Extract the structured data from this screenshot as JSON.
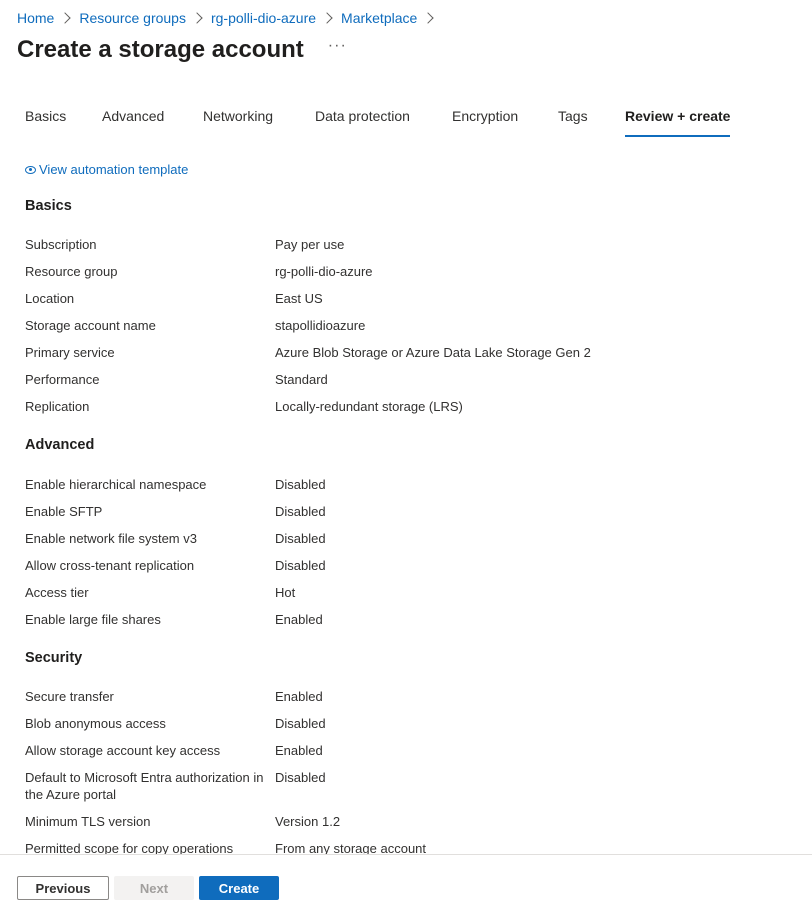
{
  "breadcrumb": [
    {
      "label": "Home"
    },
    {
      "label": "Resource groups"
    },
    {
      "label": "rg-polli-dio-azure"
    },
    {
      "label": "Marketplace"
    }
  ],
  "page": {
    "title": "Create a storage account",
    "more_label": "···"
  },
  "tabs": [
    {
      "label": "Basics"
    },
    {
      "label": "Advanced"
    },
    {
      "label": "Networking"
    },
    {
      "label": "Data protection"
    },
    {
      "label": "Encryption"
    },
    {
      "label": "Tags"
    },
    {
      "label": "Review + create",
      "active": true
    }
  ],
  "automation_link": {
    "label": "View automation template",
    "icon": "eye-icon"
  },
  "sections": [
    {
      "title": "Basics",
      "rows": [
        {
          "key": "Subscription",
          "value": "Pay per use"
        },
        {
          "key": "Resource group",
          "value": "rg-polli-dio-azure"
        },
        {
          "key": "Location",
          "value": "East US"
        },
        {
          "key": "Storage account name",
          "value": "stapollidioazure"
        },
        {
          "key": "Primary service",
          "value": "Azure Blob Storage or Azure Data Lake Storage Gen 2"
        },
        {
          "key": "Performance",
          "value": "Standard"
        },
        {
          "key": "Replication",
          "value": "Locally-redundant storage (LRS)"
        }
      ]
    },
    {
      "title": "Advanced",
      "rows": [
        {
          "key": "Enable hierarchical namespace",
          "value": "Disabled"
        },
        {
          "key": "Enable SFTP",
          "value": "Disabled"
        },
        {
          "key": "Enable network file system v3",
          "value": "Disabled"
        },
        {
          "key": "Allow cross-tenant replication",
          "value": "Disabled"
        },
        {
          "key": "Access tier",
          "value": "Hot"
        },
        {
          "key": "Enable large file shares",
          "value": "Enabled"
        }
      ]
    },
    {
      "title": "Security",
      "rows": [
        {
          "key": "Secure transfer",
          "value": "Enabled"
        },
        {
          "key": "Blob anonymous access",
          "value": "Disabled"
        },
        {
          "key": "Allow storage account key access",
          "value": "Enabled"
        },
        {
          "key": "Default to Microsoft Entra authorization in the Azure portal",
          "value": "Disabled"
        },
        {
          "key": "Minimum TLS version",
          "value": "Version 1.2"
        },
        {
          "key": "Permitted scope for copy operations",
          "value": "From any storage account"
        }
      ]
    }
  ],
  "footer": {
    "previous_label": "Previous",
    "next_label": "Next",
    "create_label": "Create"
  },
  "colors": {
    "accent": "#0f6cbd",
    "text": "#323130",
    "disabled_bg": "#f3f2f1"
  }
}
